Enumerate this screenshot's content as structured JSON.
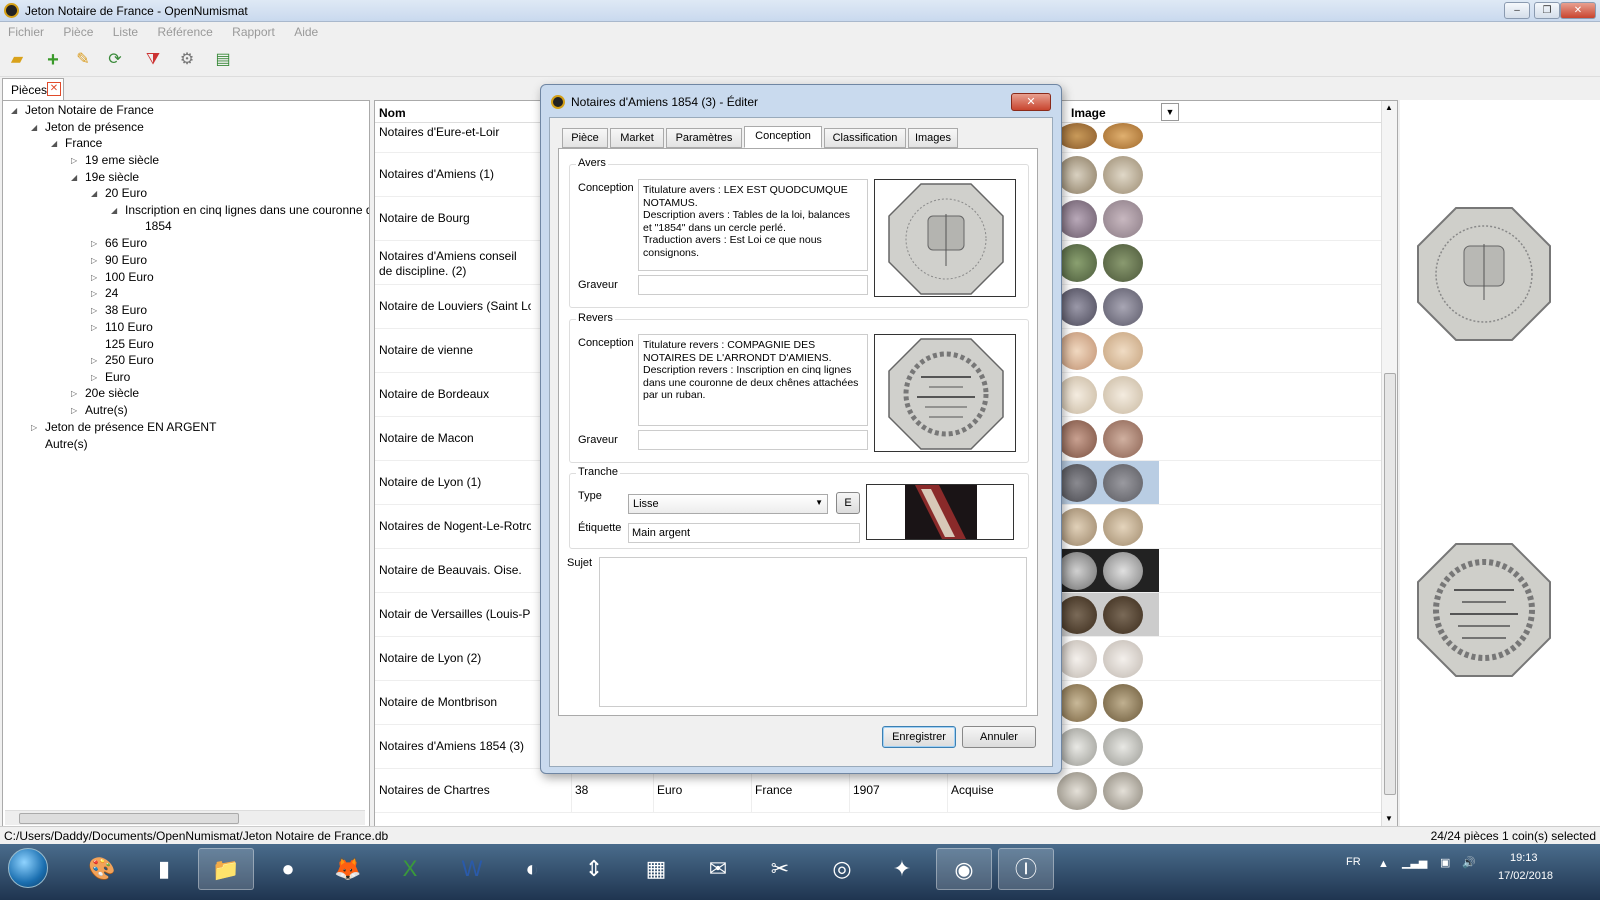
{
  "window": {
    "title": "Jeton Notaire de France - OpenNumismat",
    "min": "‒",
    "max": "❐",
    "close": "✕"
  },
  "menu": [
    "Fichier",
    "Pièce",
    "Liste",
    "Référence",
    "Rapport",
    "Aide"
  ],
  "toolbar_icons": [
    "open-folder-icon",
    "add-icon",
    "edit-icon",
    "refresh-icon",
    "filter-clear-icon",
    "settings-icon",
    "table-view-icon"
  ],
  "tabs": {
    "pieces": "Pièces"
  },
  "tree": [
    {
      "label": "Jeton Notaire de France",
      "arrow": "◢"
    },
    {
      "label": "Jeton de présence",
      "arrow": "◢"
    },
    {
      "label": "France",
      "arrow": "◢"
    },
    {
      "label": "19 eme siècle",
      "arrow": "▷"
    },
    {
      "label": "19e siècle",
      "arrow": "◢"
    },
    {
      "label": "20 Euro",
      "arrow": "◢"
    },
    {
      "label": "Inscription en cinq lignes dans une couronne de",
      "arrow": "◢"
    },
    {
      "label": "1854",
      "arrow": ""
    },
    {
      "label": "66 Euro",
      "arrow": "▷"
    },
    {
      "label": "90 Euro",
      "arrow": "▷"
    },
    {
      "label": "100 Euro",
      "arrow": "▷"
    },
    {
      "label": "24",
      "arrow": "▷"
    },
    {
      "label": "38 Euro",
      "arrow": "▷"
    },
    {
      "label": "110 Euro",
      "arrow": "▷"
    },
    {
      "label": "125 Euro",
      "arrow": ""
    },
    {
      "label": "250 Euro",
      "arrow": "▷"
    },
    {
      "label": "Euro",
      "arrow": "▷"
    },
    {
      "label": "20e siècle",
      "arrow": "▷"
    },
    {
      "label": "Autre(s)",
      "arrow": "▷"
    },
    {
      "label": "Jeton de présence EN ARGENT",
      "arrow": "▷"
    },
    {
      "label": "Autre(s)",
      "arrow": ""
    }
  ],
  "grid": {
    "headers": {
      "name": "Nom",
      "image": "Image"
    },
    "rows": [
      "Notaires d'Eure-et-Loir",
      "Notaires d'Amiens    (1)",
      "Notaire de Bourg",
      "Notaires d'Amiens conseil de discipline.    (2)",
      "Notaire de Louviers (Saint Lou",
      "Notaire de vienne",
      "Notaire de Bordeaux",
      "Notaire de Macon",
      "Notaire de Lyon    (1)",
      "Notaires de Nogent-Le-Rotro",
      "Notaire de Beauvais. Oise.",
      "Notair de Versailles (Louis-Ph",
      "Notaire de Lyon    (2)",
      "Notaire de Montbrison",
      "Notaires d'Amiens 1854    (3)"
    ],
    "last_row": {
      "name": "Notaires de Chartres",
      "value": "38",
      "unit": "Euro",
      "country": "France",
      "year": "1907",
      "status": "Acquise"
    }
  },
  "dialog": {
    "title": "Notaires d'Amiens 1854    (3) - Éditer",
    "tabs": [
      "Pièce",
      "Market",
      "Paramètres",
      "Conception",
      "Classification",
      "Images"
    ],
    "avers": {
      "group": "Avers",
      "conception_label": "Conception",
      "conception_text": "Titulature avers : LEX EST QUODCUMQUE\nNOTAMUS.\nDescription avers : Tables de la loi, balances\net \"1854\" dans un cercle perlé.\nTraduction avers : Est Loi ce que nous\nconsignons.",
      "graveur_label": "Graveur",
      "graveur_value": ""
    },
    "revers": {
      "group": "Revers",
      "conception_label": "Conception",
      "conception_text": "Titulature revers : COMPAGNIE DES\nNOTAIRES DE L'ARRONDT D'AMIENS.\nDescription revers : Inscription en cinq lignes\ndans une couronne de deux chênes attachées\npar un ruban.",
      "graveur_label": "Graveur",
      "graveur_value": ""
    },
    "tranche": {
      "group": "Tranche",
      "type_label": "Type",
      "type_value": "Lisse",
      "edit_button": "E",
      "etiquette_label": "Étiquette",
      "etiquette_value": "Main argent"
    },
    "sujet_label": "Sujet",
    "save": "Enregistrer",
    "cancel": "Annuler"
  },
  "status": {
    "path": "C:/Users/Daddy/Documents/OpenNumismat/Jeton Notaire de France.db",
    "count": "24/24 pièces 1 coin(s) selected"
  },
  "tray": {
    "lang": "FR",
    "time": "19:13",
    "date": "17/02/2018"
  },
  "colors": {
    "accent": "#3c7fb1",
    "selection": "#b9cde3",
    "silver": "#c8c8c4",
    "bronze": "#a07a50"
  }
}
